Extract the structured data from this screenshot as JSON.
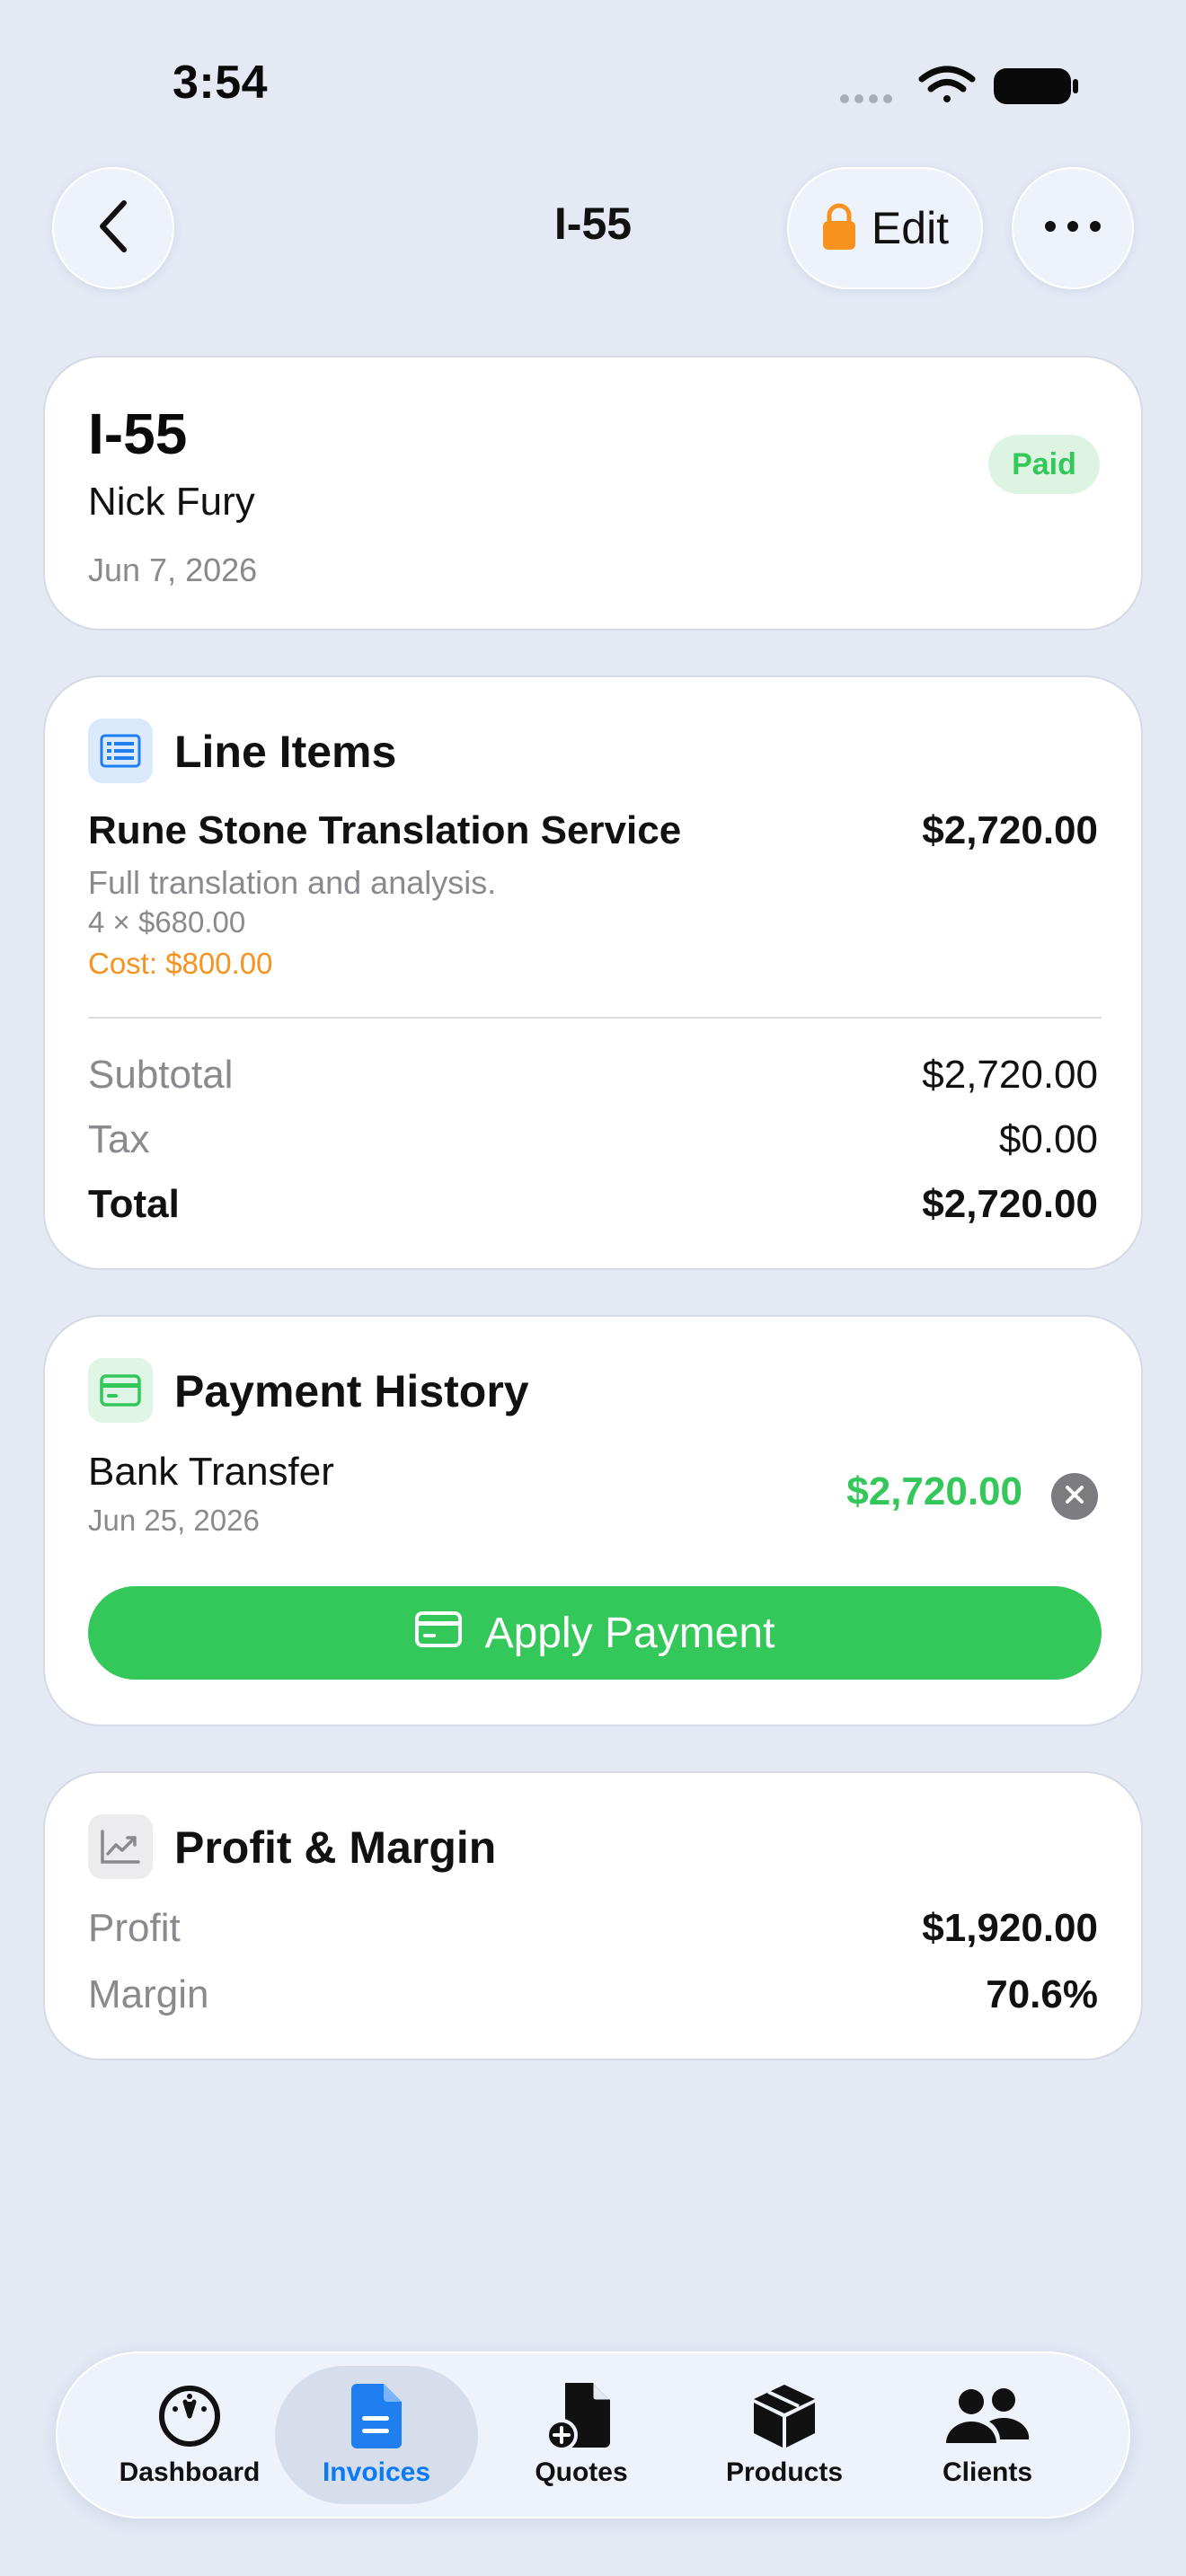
{
  "status_bar": {
    "time": "3:54"
  },
  "nav": {
    "title": "I-55",
    "edit_label": "Edit",
    "back_icon": "chevron-left-icon",
    "more_icon": "ellipsis-icon",
    "lock_color": "#f7921e"
  },
  "invoice": {
    "number": "I-55",
    "client": "Nick Fury",
    "date": "Jun 7, 2026",
    "status": "Paid"
  },
  "line_items": {
    "title": "Line Items",
    "items": [
      {
        "name": "Rune Stone Translation Service",
        "amount": "$2,720.00",
        "description": "Full translation and analysis.",
        "quantity_line": "4 × $680.00",
        "cost_line": "Cost: $800.00"
      }
    ],
    "subtotal_label": "Subtotal",
    "subtotal_value": "$2,720.00",
    "tax_label": "Tax",
    "tax_value": "$0.00",
    "total_label": "Total",
    "total_value": "$2,720.00"
  },
  "payment_history": {
    "title": "Payment History",
    "payments": [
      {
        "method": "Bank Transfer",
        "date": "Jun 25, 2026",
        "amount": "$2,720.00"
      }
    ],
    "apply_label": "Apply Payment"
  },
  "profit_margin": {
    "title": "Profit & Margin",
    "profit_label": "Profit",
    "profit_value": "$1,920.00",
    "margin_label": "Margin",
    "margin_value": "70.6%"
  },
  "tabbar": {
    "active": "Invoices",
    "tabs": [
      {
        "label": "Dashboard",
        "icon": "gauge-icon"
      },
      {
        "label": "Invoices",
        "icon": "document-icon"
      },
      {
        "label": "Quotes",
        "icon": "document-add-icon"
      },
      {
        "label": "Products",
        "icon": "box-icon"
      },
      {
        "label": "Clients",
        "icon": "people-icon"
      }
    ]
  },
  "colors": {
    "background": "#e4e9f4",
    "accent_blue": "#0a7af5",
    "success_green": "#34c759",
    "cost_orange": "#f7921e"
  }
}
